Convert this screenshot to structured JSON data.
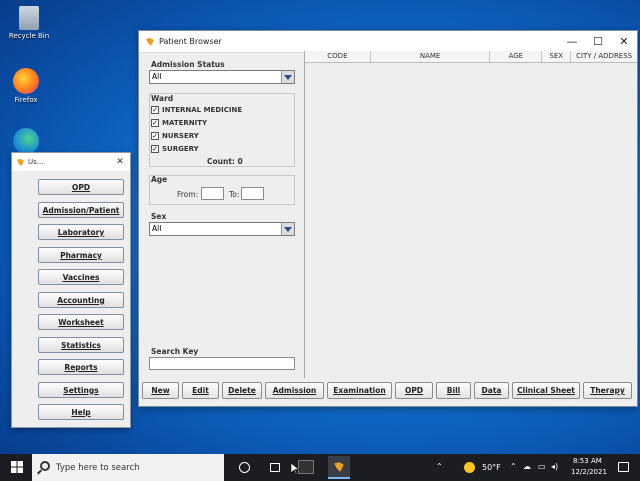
{
  "desktop": {
    "icons": [
      {
        "label": "Recycle Bin"
      },
      {
        "label": "Firefox"
      }
    ]
  },
  "main_window": {
    "title": "Patient Browser",
    "controls": {
      "minimize": "—",
      "maximize": "☐",
      "close": "✕"
    },
    "admission_status": {
      "label": "Admission Status",
      "value": "All"
    },
    "ward": {
      "label": "Ward",
      "items": [
        {
          "label": "INTERNAL MEDICINE",
          "checked": "✓"
        },
        {
          "label": "MATERNITY",
          "checked": "✓"
        },
        {
          "label": "NURSERY",
          "checked": "✓"
        },
        {
          "label": "SURGERY",
          "checked": "✓"
        }
      ],
      "count": "Count: 0"
    },
    "age": {
      "label": "Age",
      "from_label": "From:",
      "to_label": "To:"
    },
    "sex": {
      "label": "Sex",
      "value": "All"
    },
    "search_key": {
      "label": "Search Key",
      "value": ""
    },
    "table": {
      "columns": [
        "CODE",
        "NAME",
        "AGE",
        "SEX",
        "CITY / ADDRESS"
      ]
    },
    "buttons": [
      "New",
      "Edit",
      "Delete",
      "Admission",
      "Examination",
      "OPD",
      "Bill",
      "Data",
      "Clinical Sheet",
      "Therapy"
    ]
  },
  "menu_window": {
    "title": "Us...",
    "close": "✕",
    "buttons": [
      "OPD",
      "Admission/Patient",
      "Laboratory",
      "Pharmacy",
      "Vaccines",
      "Accounting",
      "Worksheet",
      "Statistics",
      "Reports",
      "Settings",
      "Help"
    ]
  },
  "taskbar": {
    "search_placeholder": "Type here to search",
    "weather": "50°F",
    "time": "8:53 AM",
    "date": "12/2/2021"
  }
}
